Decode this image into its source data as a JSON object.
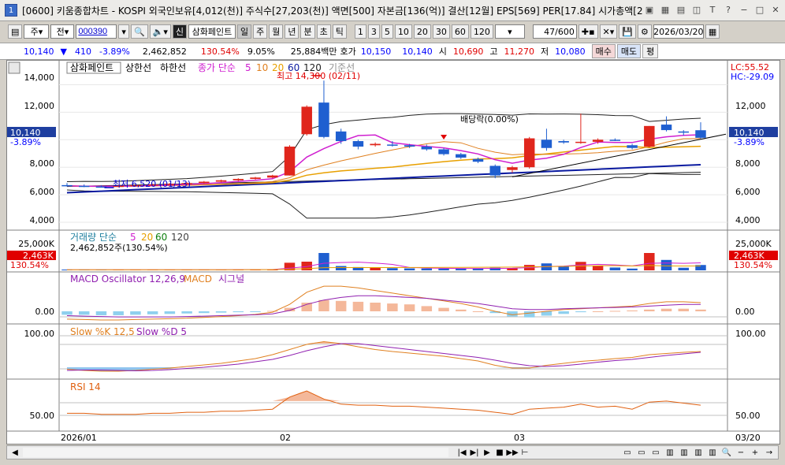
{
  "window": {
    "title": "[0600] 키움종합차트 - KOSPI 외국인보유[4,012(천)] 주식수[27,203(천)] 액면[500] 자본금[136(억)] 결산[12월] EPS[569] PER[17.84] 시가총액[2",
    "icon_label": "1"
  },
  "toolbar": {
    "period_label": "주",
    "prev_label": "전",
    "code_value": "000390",
    "mode_new": "신",
    "name_label": "삼화페인트",
    "day_label": "일",
    "week_label": "주",
    "month_label": "월",
    "year_label": "년",
    "minute_label": "분",
    "second_label": "초",
    "tick_label": "틱",
    "intervals": [
      "1",
      "3",
      "5",
      "10",
      "20",
      "30",
      "60",
      "120"
    ],
    "count_value": "47",
    "count_max": "/600",
    "date_value": "2026/03/20"
  },
  "quote": {
    "price": "10,140",
    "change": "410",
    "change_pct": "-3.89%",
    "volume": "2,462,852",
    "volume_ratio": "130.54%",
    "turnover": "9.05%",
    "amount": "25,884백만",
    "quote_label": "호가",
    "ask": "10,150",
    "bid": "10,140",
    "open_label": "시",
    "open": "10,690",
    "high_label": "고",
    "high": "11,270",
    "low_label": "저",
    "low": "10,080",
    "buy_label": "매수",
    "sell_label": "매도",
    "avg_label": "평"
  },
  "main_chart": {
    "legend_name": "삼화페인트",
    "legend_upper": "상한선",
    "legend_lower": "하한선",
    "legend_ma_prefix": "종가 단순",
    "legend_ma": [
      "5",
      "10",
      "20",
      "60",
      "120"
    ],
    "legend_base": "기준선",
    "lc": "LC:55.52",
    "hc": "HC:-29.09",
    "y_ticks": [
      "14,000",
      "12,000",
      "10,000",
      "8,000",
      "6,000",
      "4,000"
    ],
    "price_badge": "10,140",
    "change_badge": "-3.89%",
    "high_note": "최고 14,300 (02/11)",
    "low_note": "최저 6,520 (01/13)",
    "dividend_note": "배당락(0.00%)"
  },
  "volume_panel": {
    "title": "거래량 단순",
    "ma": [
      "5",
      "20",
      "60",
      "120"
    ],
    "value_text": "2,462,852주(130.54%)",
    "y_tick": "25,000K",
    "badge": "2,463K",
    "badge_pct": "130.54%"
  },
  "macd_panel": {
    "title": "MACD Oscillator 12,26,9",
    "macd_label": "MACD",
    "signal_label": "시그널",
    "y_tick": "0.00"
  },
  "stoch_panel": {
    "k_label": "Slow %K 12,5",
    "d_label": "Slow %D 5",
    "y_tick": "100.00"
  },
  "rsi_panel": {
    "title": "RSI 14",
    "y_tick": "50.00"
  },
  "x_axis": {
    "labels": [
      "2026/01",
      "02",
      "03"
    ],
    "right_label": "03/20"
  },
  "colors": {
    "up": "#e0261c",
    "down": "#1f5fd0",
    "ma5": "#d020d0",
    "ma10": "#e08020",
    "ma20": "#e8a000",
    "ma60": "#0a1aa0",
    "ma120": "#202020",
    "bollinger": "#202020"
  },
  "chart_data": {
    "type": "candlestick",
    "candles": [
      {
        "o": 6700,
        "h": 6850,
        "l": 6600,
        "c": 6650
      },
      {
        "o": 6650,
        "h": 6750,
        "l": 6550,
        "c": 6600
      },
      {
        "o": 6600,
        "h": 6700,
        "l": 6520,
        "c": 6580
      },
      {
        "o": 6580,
        "h": 6700,
        "l": 6550,
        "c": 6650
      },
      {
        "o": 6650,
        "h": 6750,
        "l": 6600,
        "c": 6700
      },
      {
        "o": 6700,
        "h": 6800,
        "l": 6650,
        "c": 6750
      },
      {
        "o": 6750,
        "h": 6850,
        "l": 6700,
        "c": 6800
      },
      {
        "o": 6800,
        "h": 6900,
        "l": 6750,
        "c": 6850
      },
      {
        "o": 6850,
        "h": 7000,
        "l": 6800,
        "c": 6950
      },
      {
        "o": 6950,
        "h": 7100,
        "l": 6900,
        "c": 7050
      },
      {
        "o": 7050,
        "h": 7200,
        "l": 7000,
        "c": 7150
      },
      {
        "o": 7150,
        "h": 7300,
        "l": 7100,
        "c": 7250
      },
      {
        "o": 7250,
        "h": 7450,
        "l": 7200,
        "c": 7400
      },
      {
        "o": 7400,
        "h": 9600,
        "l": 7400,
        "c": 9500
      },
      {
        "o": 10400,
        "h": 12500,
        "l": 10300,
        "c": 12400
      },
      {
        "o": 12700,
        "h": 14300,
        "l": 10100,
        "c": 10200
      },
      {
        "o": 10600,
        "h": 10800,
        "l": 9700,
        "c": 9900
      },
      {
        "o": 9900,
        "h": 10000,
        "l": 9300,
        "c": 9500
      },
      {
        "o": 9600,
        "h": 9800,
        "l": 9500,
        "c": 9700
      },
      {
        "o": 9650,
        "h": 9900,
        "l": 9500,
        "c": 9600
      },
      {
        "o": 9600,
        "h": 9700,
        "l": 9400,
        "c": 9500
      },
      {
        "o": 9500,
        "h": 9650,
        "l": 9200,
        "c": 9300
      },
      {
        "o": 9300,
        "h": 9400,
        "l": 8850,
        "c": 8950
      },
      {
        "o": 8950,
        "h": 9050,
        "l": 8600,
        "c": 8700
      },
      {
        "o": 8600,
        "h": 8700,
        "l": 8300,
        "c": 8400
      },
      {
        "o": 8100,
        "h": 8200,
        "l": 7200,
        "c": 7400
      },
      {
        "o": 7800,
        "h": 8100,
        "l": 7600,
        "c": 8000
      },
      {
        "o": 8000,
        "h": 10200,
        "l": 7900,
        "c": 10100
      },
      {
        "o": 10000,
        "h": 10800,
        "l": 9200,
        "c": 9400
      },
      {
        "o": 9900,
        "h": 10000,
        "l": 9700,
        "c": 9800
      },
      {
        "o": 9800,
        "h": 11900,
        "l": 9700,
        "c": 9850
      },
      {
        "o": 9850,
        "h": 10100,
        "l": 9700,
        "c": 10000
      },
      {
        "o": 10000,
        "h": 10100,
        "l": 9900,
        "c": 9950
      },
      {
        "o": 9600,
        "h": 9700,
        "l": 9300,
        "c": 9400
      },
      {
        "o": 9500,
        "h": 11000,
        "l": 9450,
        "c": 11000
      },
      {
        "o": 11100,
        "h": 11700,
        "l": 10600,
        "c": 10700
      },
      {
        "o": 10600,
        "h": 10700,
        "l": 10300,
        "c": 10550
      },
      {
        "o": 10690,
        "h": 11270,
        "l": 10080,
        "c": 10140
      }
    ],
    "volume_k": [
      300,
      280,
      260,
      300,
      320,
      300,
      280,
      300,
      320,
      340,
      360,
      380,
      420,
      3500,
      4000,
      8000,
      2000,
      1500,
      1200,
      1000,
      900,
      850,
      800,
      900,
      850,
      1200,
      1000,
      2500,
      3200,
      2000,
      3900,
      2200,
      1300,
      800,
      8000,
      4800,
      1200,
      2463
    ],
    "y_range": [
      4000,
      14600
    ],
    "volume_y_max": 25000,
    "macd_osc": [
      -0.4,
      -0.4,
      -0.45,
      -0.45,
      -0.4,
      -0.35,
      -0.3,
      -0.25,
      -0.2,
      -0.15,
      -0.1,
      -0.05,
      0.05,
      0.4,
      1.0,
      1.3,
      1.2,
      1.1,
      1.0,
      0.9,
      0.8,
      0.6,
      0.4,
      0.2,
      0.0,
      -0.2,
      -0.6,
      -0.7,
      -0.5,
      -0.3,
      -0.1,
      0.0,
      0.05,
      0.1,
      0.2,
      0.3,
      0.3,
      0.2
    ],
    "macd_line": [
      -0.9,
      -0.95,
      -1.0,
      -1.0,
      -0.95,
      -0.9,
      -0.85,
      -0.8,
      -0.7,
      -0.6,
      -0.5,
      -0.35,
      -0.1,
      0.8,
      2.2,
      2.9,
      2.9,
      2.7,
      2.4,
      2.1,
      1.8,
      1.5,
      1.2,
      0.9,
      0.5,
      0.0,
      -0.4,
      -0.2,
      0.0,
      0.2,
      0.3,
      0.4,
      0.5,
      0.6,
      0.9,
      1.1,
      1.1,
      1.0
    ],
    "signal_line": [
      -0.5,
      -0.55,
      -0.6,
      -0.65,
      -0.65,
      -0.65,
      -0.65,
      -0.6,
      -0.55,
      -0.5,
      -0.45,
      -0.4,
      -0.3,
      0.1,
      0.8,
      1.3,
      1.6,
      1.8,
      1.8,
      1.7,
      1.6,
      1.5,
      1.3,
      1.1,
      0.9,
      0.6,
      0.3,
      0.2,
      0.2,
      0.3,
      0.35,
      0.4,
      0.45,
      0.5,
      0.6,
      0.7,
      0.8,
      0.8
    ],
    "stoch_k": [
      15,
      12,
      10,
      10,
      12,
      15,
      18,
      22,
      26,
      30,
      36,
      42,
      52,
      65,
      78,
      85,
      80,
      72,
      65,
      60,
      56,
      52,
      48,
      42,
      36,
      25,
      18,
      18,
      25,
      30,
      35,
      38,
      42,
      45,
      52,
      55,
      58,
      60
    ],
    "stoch_d": [
      12,
      13,
      13,
      12,
      11,
      12,
      14,
      17,
      20,
      24,
      28,
      34,
      40,
      50,
      62,
      72,
      80,
      80,
      75,
      70,
      65,
      60,
      55,
      50,
      45,
      38,
      30,
      24,
      22,
      24,
      28,
      33,
      37,
      40,
      45,
      50,
      54,
      58
    ],
    "rsi": [
      46,
      46,
      45,
      45,
      45,
      46,
      46,
      47,
      47,
      48,
      48,
      49,
      50,
      62,
      68,
      60,
      55,
      54,
      54,
      53,
      53,
      52,
      51,
      50,
      49,
      47,
      45,
      50,
      51,
      52,
      55,
      52,
      53,
      50,
      57,
      58,
      56,
      54
    ]
  }
}
